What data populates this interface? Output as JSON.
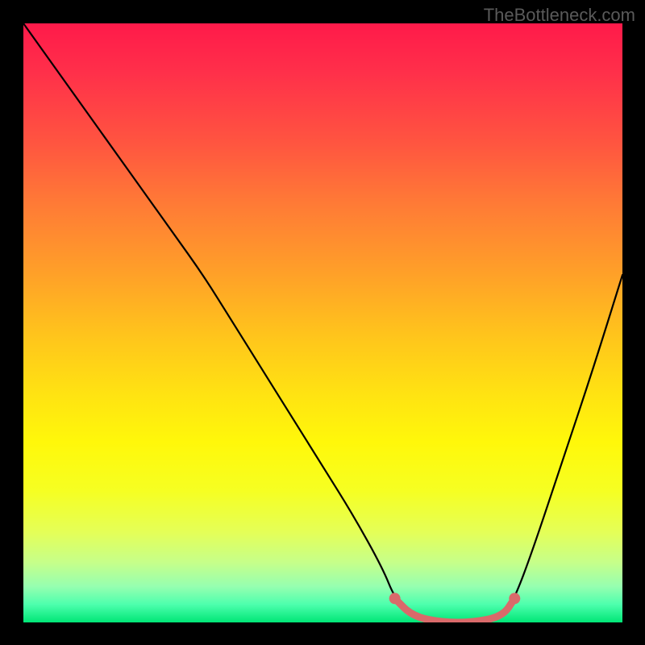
{
  "watermark": "TheBottleneck.com",
  "chart_data": {
    "type": "line",
    "title": "",
    "xlabel": "",
    "ylabel": "",
    "xlim": [
      0,
      100
    ],
    "ylim": [
      0,
      100
    ],
    "series": [
      {
        "name": "bottleneck-curve",
        "x": [
          0,
          5,
          10,
          15,
          20,
          25,
          30,
          35,
          40,
          45,
          50,
          55,
          60,
          62,
          65,
          70,
          75,
          80,
          82,
          85,
          90,
          95,
          100
        ],
        "y": [
          100,
          93,
          86,
          79,
          72,
          65,
          58,
          50,
          42,
          34,
          26,
          18,
          9,
          4,
          1,
          0,
          0,
          1,
          4,
          12,
          27,
          42,
          58
        ]
      },
      {
        "name": "highlight-segment",
        "x": [
          62,
          65,
          70,
          75,
          80,
          82
        ],
        "y": [
          4,
          1,
          0,
          0,
          1,
          4
        ]
      }
    ],
    "gradient_colors": {
      "top": "#ff1a4a",
      "mid_upper": "#ffa128",
      "mid": "#ffe312",
      "mid_lower": "#e4ff58",
      "bottom": "#00e676"
    },
    "highlight_color": "#d96a6a"
  }
}
